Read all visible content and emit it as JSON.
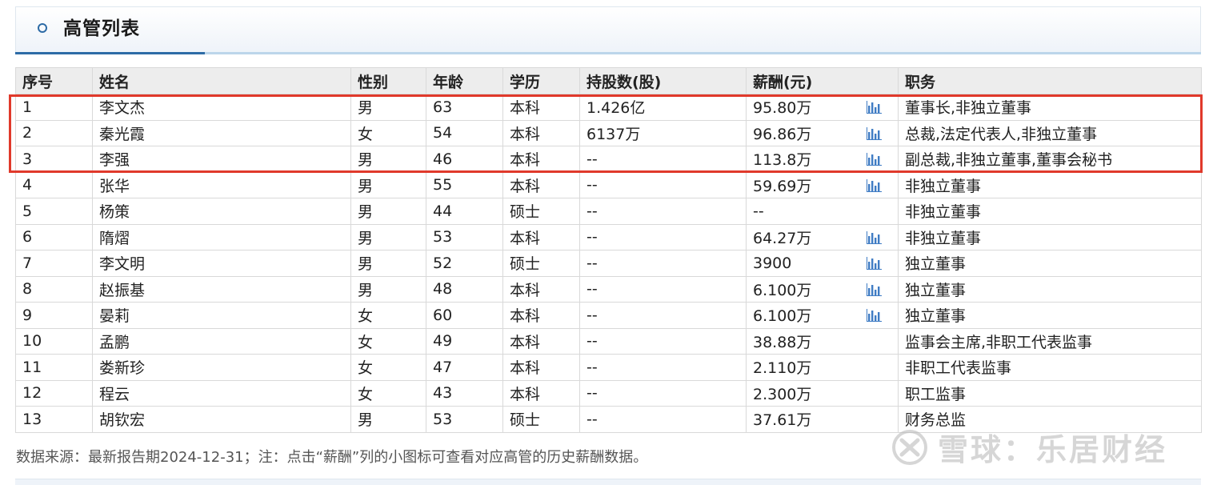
{
  "section": {
    "title": "高管列表"
  },
  "table": {
    "headers": [
      "序号",
      "姓名",
      "性别",
      "年龄",
      "学历",
      "持股数(股)",
      "薪酬(元)",
      "职务"
    ],
    "rows": [
      {
        "no": "1",
        "name": "李文杰",
        "gender": "男",
        "age": "63",
        "education": "本科",
        "shares": "1.426亿",
        "salary": "95.80万",
        "has_chart": true,
        "position": "董事长,非独立董事"
      },
      {
        "no": "2",
        "name": "秦光霞",
        "gender": "女",
        "age": "54",
        "education": "本科",
        "shares": "6137万",
        "salary": "96.86万",
        "has_chart": true,
        "position": "总裁,法定代表人,非独立董事"
      },
      {
        "no": "3",
        "name": "李强",
        "gender": "男",
        "age": "46",
        "education": "本科",
        "shares": "--",
        "salary": "113.8万",
        "has_chart": true,
        "position": "副总裁,非独立董事,董事会秘书"
      },
      {
        "no": "4",
        "name": "张华",
        "gender": "男",
        "age": "55",
        "education": "本科",
        "shares": "--",
        "salary": "59.69万",
        "has_chart": true,
        "position": "非独立董事"
      },
      {
        "no": "5",
        "name": "杨策",
        "gender": "男",
        "age": "44",
        "education": "硕士",
        "shares": "--",
        "salary": "--",
        "has_chart": false,
        "position": "非独立董事"
      },
      {
        "no": "6",
        "name": "隋熠",
        "gender": "男",
        "age": "53",
        "education": "本科",
        "shares": "--",
        "salary": "64.27万",
        "has_chart": true,
        "position": "非独立董事"
      },
      {
        "no": "7",
        "name": "李文明",
        "gender": "男",
        "age": "52",
        "education": "硕士",
        "shares": "--",
        "salary": "3900",
        "has_chart": true,
        "position": "独立董事"
      },
      {
        "no": "8",
        "name": "赵振基",
        "gender": "男",
        "age": "48",
        "education": "本科",
        "shares": "--",
        "salary": "6.100万",
        "has_chart": true,
        "position": "独立董事"
      },
      {
        "no": "9",
        "name": "晏莉",
        "gender": "女",
        "age": "60",
        "education": "本科",
        "shares": "--",
        "salary": "6.100万",
        "has_chart": true,
        "position": "独立董事"
      },
      {
        "no": "10",
        "name": "孟鹏",
        "gender": "女",
        "age": "49",
        "education": "本科",
        "shares": "--",
        "salary": "38.88万",
        "has_chart": false,
        "position": "监事会主席,非职工代表监事"
      },
      {
        "no": "11",
        "name": "娄新珍",
        "gender": "女",
        "age": "47",
        "education": "本科",
        "shares": "--",
        "salary": "2.110万",
        "has_chart": false,
        "position": "非职工代表监事"
      },
      {
        "no": "12",
        "name": "程云",
        "gender": "女",
        "age": "43",
        "education": "本科",
        "shares": "--",
        "salary": "2.300万",
        "has_chart": false,
        "position": "职工监事"
      },
      {
        "no": "13",
        "name": "胡钦宏",
        "gender": "男",
        "age": "53",
        "education": "硕士",
        "shares": "--",
        "salary": "37.61万",
        "has_chart": false,
        "position": "财务总监"
      }
    ]
  },
  "footnote": "数据来源：最新报告期2024-12-31；注：点击“薪酬”列的小图标可查看对应高管的历史薪酬数据。",
  "watermark": "雪球：乐居财经",
  "icons": {
    "section_marker": "circle-icon",
    "salary_history": "bar-chart-icon",
    "watermark_logo": "snowball-logo"
  },
  "colors": {
    "accent": "#2d6ba6",
    "highlight_border": "#e0392b",
    "header_bg": "#ededed",
    "chart_icon": "#3f7cc4"
  }
}
